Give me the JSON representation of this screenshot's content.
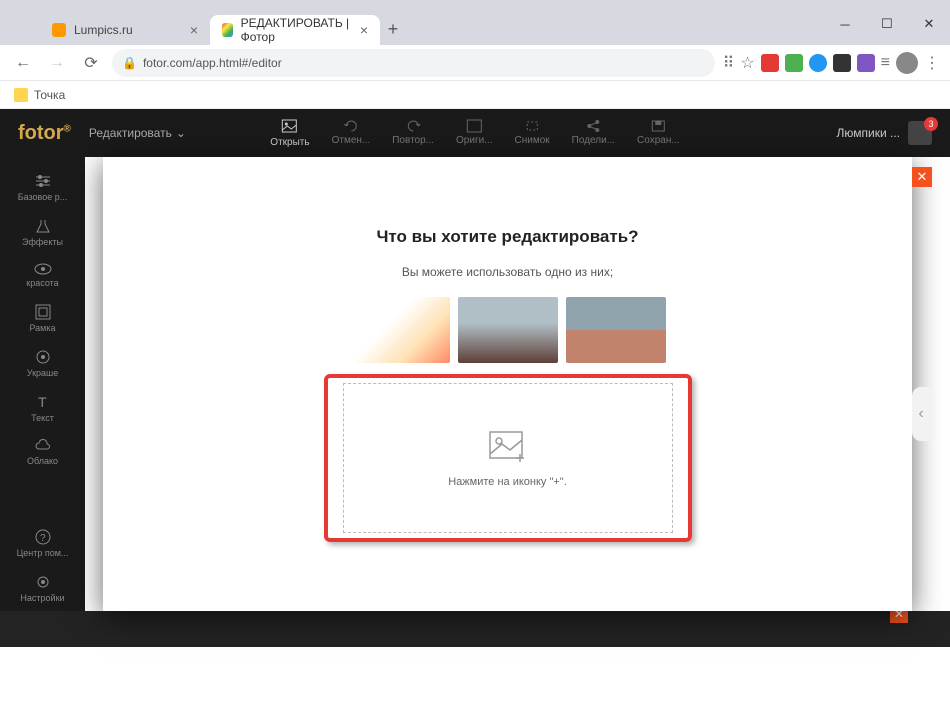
{
  "browser": {
    "tabs": [
      {
        "title": "Lumpics.ru"
      },
      {
        "title": "РЕДАКТИРОВАТЬ | Фотор"
      }
    ],
    "url": "fotor.com/app.html#/editor",
    "bookmark": "Точка"
  },
  "header": {
    "logo": "fotor",
    "dropdown": "Редактировать",
    "tools": {
      "open": "Открыть",
      "undo": "Отмен...",
      "redo": "Повтор...",
      "original": "Ориги...",
      "snapshot": "Снимок",
      "share": "Подели...",
      "save": "Сохран..."
    },
    "username": "Люмпики ...",
    "notif_count": "3"
  },
  "sidebar": {
    "basic": "Базовое р...",
    "effects": "Эффекты",
    "beauty": "красота",
    "frame": "Рамка",
    "sticker": "Украше",
    "text": "Текст",
    "cloud": "Облако",
    "help": "Центр пом...",
    "settings": "Настройки"
  },
  "modal": {
    "title": "Что вы хотите редактировать?",
    "subtitle": "Вы можете использовать одно из них;",
    "dropzone_text": "Нажмите на иконку \"+\"."
  }
}
